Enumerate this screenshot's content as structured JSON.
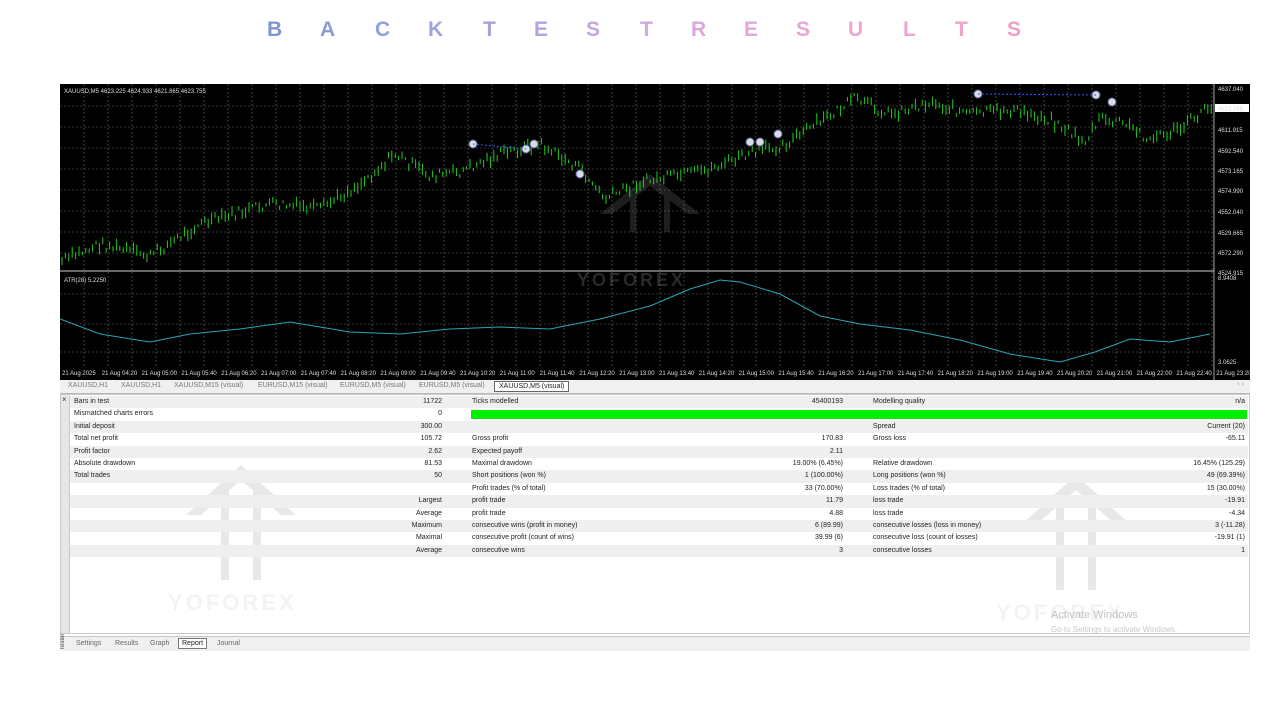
{
  "title": {
    "letters": [
      "B",
      "A",
      "C",
      "K",
      "T",
      "E",
      "S",
      "T",
      "R",
      "E",
      "S",
      "U",
      "L",
      "T",
      "S"
    ],
    "colors": [
      "#7d96cf",
      "#8a9bd5",
      "#94a0d8",
      "#9fa4dc",
      "#ab9fd9",
      "#b6a2dc",
      "#c3a7df",
      "#cfaadf",
      "#d9a7dc",
      "#e0a7da",
      "#e6a6d7",
      "#eba7d4",
      "#eea5cf",
      "#f0a2c9",
      "#f09fc4"
    ]
  },
  "chart": {
    "header": "XAUUSD,M5  4623.225 4624.933 4621.865 4623.755",
    "price_labels": [
      "4637.040",
      "4623.755",
      "4611.915",
      "4592.540",
      "4573.165",
      "4574.990",
      "4552.040",
      "4529.665",
      "4572.290",
      "4524.915"
    ],
    "current_price": "4623.755",
    "indicator_header": "ATR(28) 5.2250",
    "indicator_labels": [
      "8.9408",
      "3.0625"
    ],
    "time_labels": [
      "21 Aug 2025",
      "21 Aug 04:20",
      "21 Aug 05:00",
      "21 Aug 05:40",
      "21 Aug 06:20",
      "21 Aug 07:00",
      "21 Aug 07:40",
      "21 Aug 08:20",
      "21 Aug 09:00",
      "21 Aug 09:40",
      "21 Aug 10:20",
      "21 Aug 11:00",
      "21 Aug 11:40",
      "21 Aug 12:20",
      "21 Aug 13:00",
      "21 Aug 13:40",
      "21 Aug 14:20",
      "21 Aug 15:00",
      "21 Aug 15:40",
      "21 Aug 16:20",
      "21 Aug 17:00",
      "21 Aug 17:40",
      "21 Aug 18:20",
      "21 Aug 19:00",
      "21 Aug 19:40",
      "21 Aug 20:20",
      "21 Aug 21:00",
      "21 Aug 22:00",
      "21 Aug 22:40",
      "21 Aug 23:20"
    ],
    "watermark": "YOFOREX",
    "colors": {
      "candles": "#22cc22",
      "atr": "#2aa5b5",
      "grid": "#6b6b6b",
      "background": "#000000"
    }
  },
  "chart_tabs": [
    "XAUUSD,H1",
    "XAUUSD,H1",
    "XAUUSD,M15 (visual)",
    "EURUSD,M15 (visual)",
    "EURUSD,M5 (visual)",
    "EURUSD,M5 (visual)",
    "XAUUSD,M5 (visual)"
  ],
  "chart_tabs_active": 6,
  "report": {
    "rows": [
      {
        "a": "Bars in test",
        "b": "",
        "bv": "11722",
        "c": "Ticks modelled",
        "cv": "45400193",
        "d": "Modelling quality",
        "dv": "n/a"
      },
      {
        "a": "Mismatched charts errors",
        "b": "",
        "bv": "0",
        "c": "",
        "cv": "",
        "d": "",
        "dv": "",
        "bar": true
      },
      {
        "a": "Initial deposit",
        "b": "",
        "bv": "300.00",
        "c": "",
        "cv": "",
        "d": "Spread",
        "dv": "Current (20)"
      },
      {
        "a": "Total net profit",
        "b": "",
        "bv": "105.72",
        "c": "Gross profit",
        "cv": "170.83",
        "d": "Gross loss",
        "dv": "-65.11"
      },
      {
        "a": "Profit factor",
        "b": "",
        "bv": "2.62",
        "c": "Expected payoff",
        "cv": "2.11",
        "d": "",
        "dv": ""
      },
      {
        "a": "Absolute drawdown",
        "b": "",
        "bv": "81.53",
        "c": "Maximal drawdown",
        "cv": "19.00% (6.45%)",
        "d": "Relative drawdown",
        "dv": "16.45% (125.29)"
      },
      {
        "a": "Total trades",
        "b": "",
        "bv": "50",
        "c": "Short positions (won %)",
        "cv": "1 (100.00%)",
        "d": "Long positions (won %)",
        "dv": "49 (69.39%)"
      },
      {
        "a": "",
        "b": "",
        "bv": "",
        "c": "Profit trades (% of total)",
        "cv": "33 (70.00%)",
        "d": "Loss trades (% of total)",
        "dv": "15 (30.00%)"
      },
      {
        "a": "",
        "b": "Largest",
        "bv": "",
        "c": "profit trade",
        "cv": "11.79",
        "d": "loss trade",
        "dv": "-19.91"
      },
      {
        "a": "",
        "b": "Average",
        "bv": "",
        "c": "profit trade",
        "cv": "4.88",
        "d": "loss trade",
        "dv": "-4.34"
      },
      {
        "a": "",
        "b": "Maximum",
        "bv": "",
        "c": "consecutive wins (profit in money)",
        "cv": "6 (89.99)",
        "d": "consecutive losses (loss in money)",
        "dv": "3 (-11.28)"
      },
      {
        "a": "",
        "b": "Maximal",
        "bv": "",
        "c": "consecutive profit (count of wins)",
        "cv": "39.99 (6)",
        "d": "consecutive loss (count of losses)",
        "dv": "-19.91 (1)"
      },
      {
        "a": "",
        "b": "Average",
        "bv": "",
        "c": "consecutive wins",
        "cv": "3",
        "d": "consecutive losses",
        "dv": "1"
      }
    ],
    "modelling_bar_color": "#00ee00"
  },
  "bottom_tabs": [
    "Settings",
    "Results",
    "Graph",
    "Report",
    "Journal"
  ],
  "bottom_tabs_active": 3,
  "side_label": "Tester",
  "watermark_text": "YOFOREX",
  "activate": {
    "title": "Activate Windows",
    "subtitle": "Go to Settings to activate Windows."
  }
}
